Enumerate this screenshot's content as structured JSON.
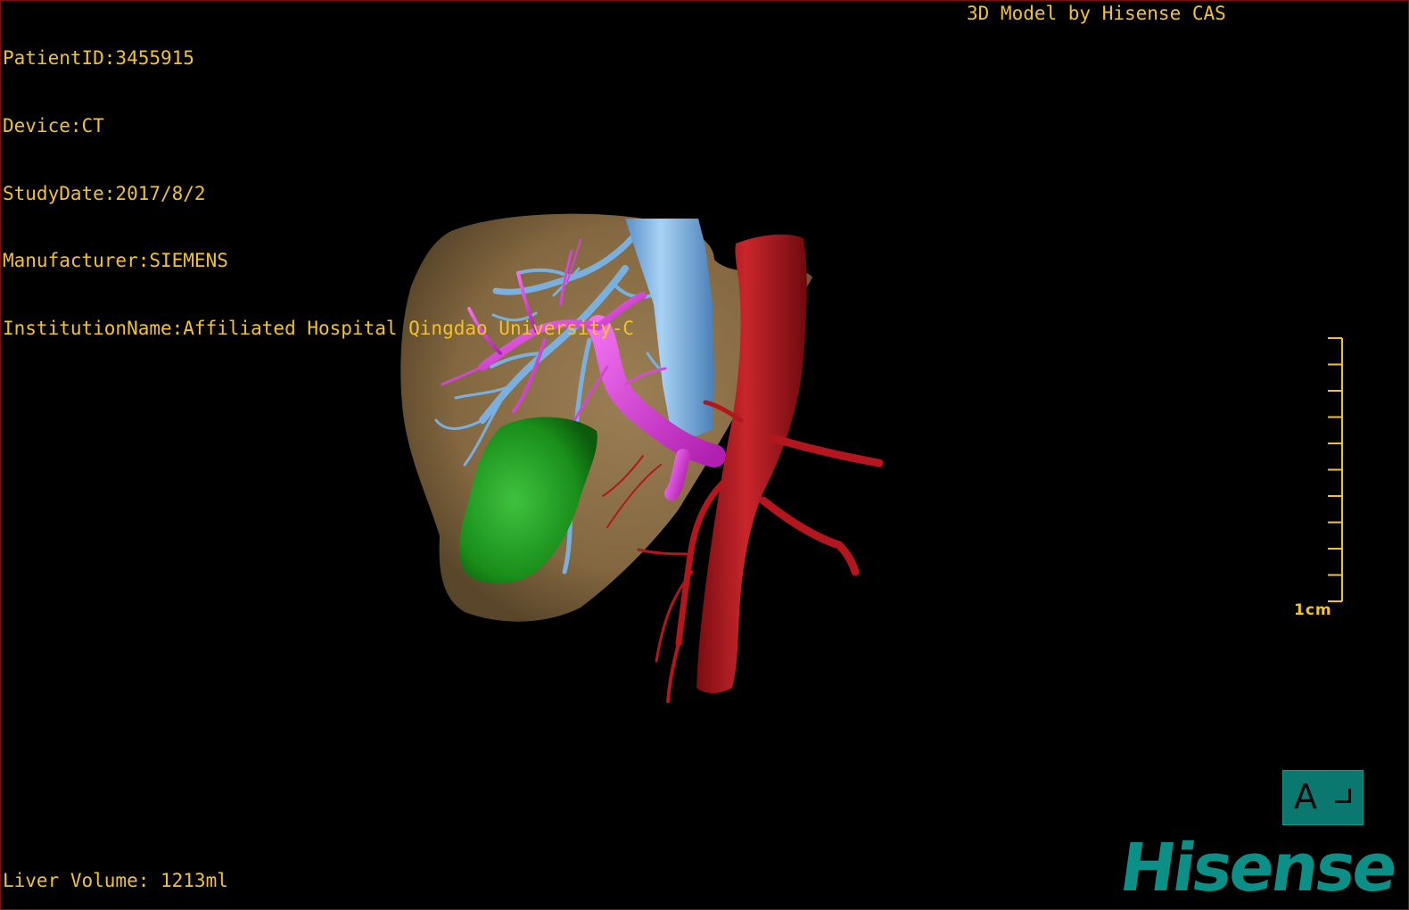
{
  "app": {
    "brand_top": "3D Model by Hisense CAS",
    "logo_text": "Hisense"
  },
  "patient_info": [
    "PatientID:3455915",
    "Device:CT",
    "StudyDate:2017/8/2",
    "Manufacturer:SIEMENS",
    "InstitutionName:Affiliated Hospital Qingdao University-C"
  ],
  "liver_volume": "Liver Volume: 1213ml",
  "scale_bar": {
    "label": "1cm",
    "tick_count": 10
  },
  "orientation": {
    "label": "A"
  },
  "colors": {
    "overlay_text": "#f2c22a",
    "background": "#000000",
    "liver": "#8b6f4a",
    "hepatic_vein": "#7ab0e0",
    "portal_vein": "#e040e0",
    "gallbladder": "#1e9a1e",
    "aorta": "#b3161c",
    "orientation_cube": "#0b7870",
    "logo": "#0b8f86",
    "border": "#7a1010"
  },
  "icons": {
    "orientation_cube": "orientation-cube-icon",
    "logo": "hisense-logo-icon"
  }
}
